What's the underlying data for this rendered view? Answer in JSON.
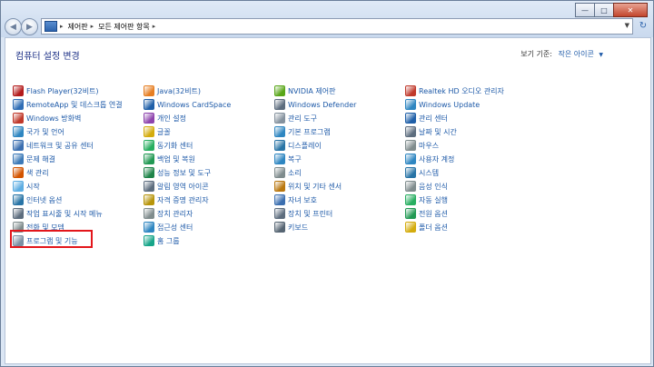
{
  "titlebar": {
    "minimize_glyph": "—",
    "maximize_glyph": "□",
    "close_glyph": "✕"
  },
  "nav": {
    "back_glyph": "◀",
    "forward_glyph": "▶",
    "breadcrumbs": [
      "제어판",
      "모든 제어판 항목"
    ],
    "separator": "▸",
    "dropdown_glyph": "▼",
    "refresh_glyph": "↻"
  },
  "main": {
    "heading": "컴퓨터 설정 변경",
    "view_label": "보기 기준:",
    "view_value": "작은 아이콘",
    "view_arrow": "▼"
  },
  "columns": [
    {
      "items": [
        {
          "label": "Flash Player(32비트)",
          "icon": "flash-icon",
          "color": "#b31b1b"
        },
        {
          "label": "RemoteApp 및 데스크톱 연결",
          "icon": "remoteapp-icon",
          "color": "#2f6db5"
        },
        {
          "label": "Windows 방화벽",
          "icon": "firewall-icon",
          "color": "#c0392b"
        },
        {
          "label": "국가 및 언어",
          "icon": "globe-icon",
          "color": "#2e86c1"
        },
        {
          "label": "네트워크 및 공유 센터",
          "icon": "network-icon",
          "color": "#3b6fb0"
        },
        {
          "label": "문제 해결",
          "icon": "troubleshoot-icon",
          "color": "#3d7ab8"
        },
        {
          "label": "색 관리",
          "icon": "color-management-icon",
          "color": "#d35400"
        },
        {
          "label": "시작",
          "icon": "getting-started-icon",
          "color": "#5dade2"
        },
        {
          "label": "인터넷 옵션",
          "icon": "internet-options-icon",
          "color": "#2874a6"
        },
        {
          "label": "작업 표시줄 및 시작 메뉴",
          "icon": "taskbar-icon",
          "color": "#5d6d7e"
        },
        {
          "label": "전화 및 모뎀",
          "icon": "phone-modem-icon",
          "color": "#7f8c8d"
        },
        {
          "label": "프로그램 및 기능",
          "icon": "programs-icon",
          "color": "#7b8fa3"
        }
      ]
    },
    {
      "items": [
        {
          "label": "Java(32비트)",
          "icon": "java-icon",
          "color": "#e67e22"
        },
        {
          "label": "Windows CardSpace",
          "icon": "cardspace-icon",
          "color": "#1f5fa8"
        },
        {
          "label": "개인 설정",
          "icon": "personalization-icon",
          "color": "#8e44ad"
        },
        {
          "label": "글꼴",
          "icon": "fonts-icon",
          "color": "#d4ac0d"
        },
        {
          "label": "동기화 센터",
          "icon": "sync-icon",
          "color": "#27ae60"
        },
        {
          "label": "백업 및 복원",
          "icon": "backup-icon",
          "color": "#229954"
        },
        {
          "label": "성능 정보 및 도구",
          "icon": "performance-icon",
          "color": "#1e8449"
        },
        {
          "label": "알림 영역 아이콘",
          "icon": "notification-icon",
          "color": "#5d6d7e"
        },
        {
          "label": "자격 증명 관리자",
          "icon": "credential-icon",
          "color": "#b7950b"
        },
        {
          "label": "장치 관리자",
          "icon": "device-manager-icon",
          "color": "#7f8c8d"
        },
        {
          "label": "접근성 센터",
          "icon": "accessibility-icon",
          "color": "#2e86c1"
        },
        {
          "label": "홈 그룹",
          "icon": "homegroup-icon",
          "color": "#17a589"
        }
      ]
    },
    {
      "items": [
        {
          "label": "NVIDIA 제어판",
          "icon": "nvidia-icon",
          "color": "#58a618"
        },
        {
          "label": "Windows Defender",
          "icon": "defender-icon",
          "color": "#5d6d7e"
        },
        {
          "label": "관리 도구",
          "icon": "admin-tools-icon",
          "color": "#85929e"
        },
        {
          "label": "기본 프로그램",
          "icon": "default-programs-icon",
          "color": "#2e86c1"
        },
        {
          "label": "디스플레이",
          "icon": "display-icon",
          "color": "#2874a6"
        },
        {
          "label": "복구",
          "icon": "recovery-icon",
          "color": "#2e86c1"
        },
        {
          "label": "소리",
          "icon": "sound-icon",
          "color": "#7f8c8d"
        },
        {
          "label": "위치 및 기타 센서",
          "icon": "sensor-icon",
          "color": "#b9770e"
        },
        {
          "label": "자녀 보호",
          "icon": "parental-icon",
          "color": "#3b6fb0"
        },
        {
          "label": "장치 및 프린터",
          "icon": "devices-printers-icon",
          "color": "#5d6d7e"
        },
        {
          "label": "키보드",
          "icon": "keyboard-icon",
          "color": "#566573"
        }
      ]
    },
    {
      "items": [
        {
          "label": "Realtek HD 오디오 관리자",
          "icon": "realtek-icon",
          "color": "#c0392b"
        },
        {
          "label": "Windows Update",
          "icon": "windows-update-icon",
          "color": "#2e86c1"
        },
        {
          "label": "관리 센터",
          "icon": "action-center-icon",
          "color": "#1f5fa8"
        },
        {
          "label": "날짜 및 시간",
          "icon": "datetime-icon",
          "color": "#5d6d7e"
        },
        {
          "label": "마우스",
          "icon": "mouse-icon",
          "color": "#7f8c8d"
        },
        {
          "label": "사용자 계정",
          "icon": "user-accounts-icon",
          "color": "#2e86c1"
        },
        {
          "label": "시스템",
          "icon": "system-icon",
          "color": "#2874a6"
        },
        {
          "label": "음성 인식",
          "icon": "speech-icon",
          "color": "#7f8c8d"
        },
        {
          "label": "자동 실행",
          "icon": "autoplay-icon",
          "color": "#27ae60"
        },
        {
          "label": "전원 옵션",
          "icon": "power-icon",
          "color": "#229954"
        },
        {
          "label": "폴더 옵션",
          "icon": "folder-options-icon",
          "color": "#d4ac0d"
        }
      ]
    }
  ]
}
